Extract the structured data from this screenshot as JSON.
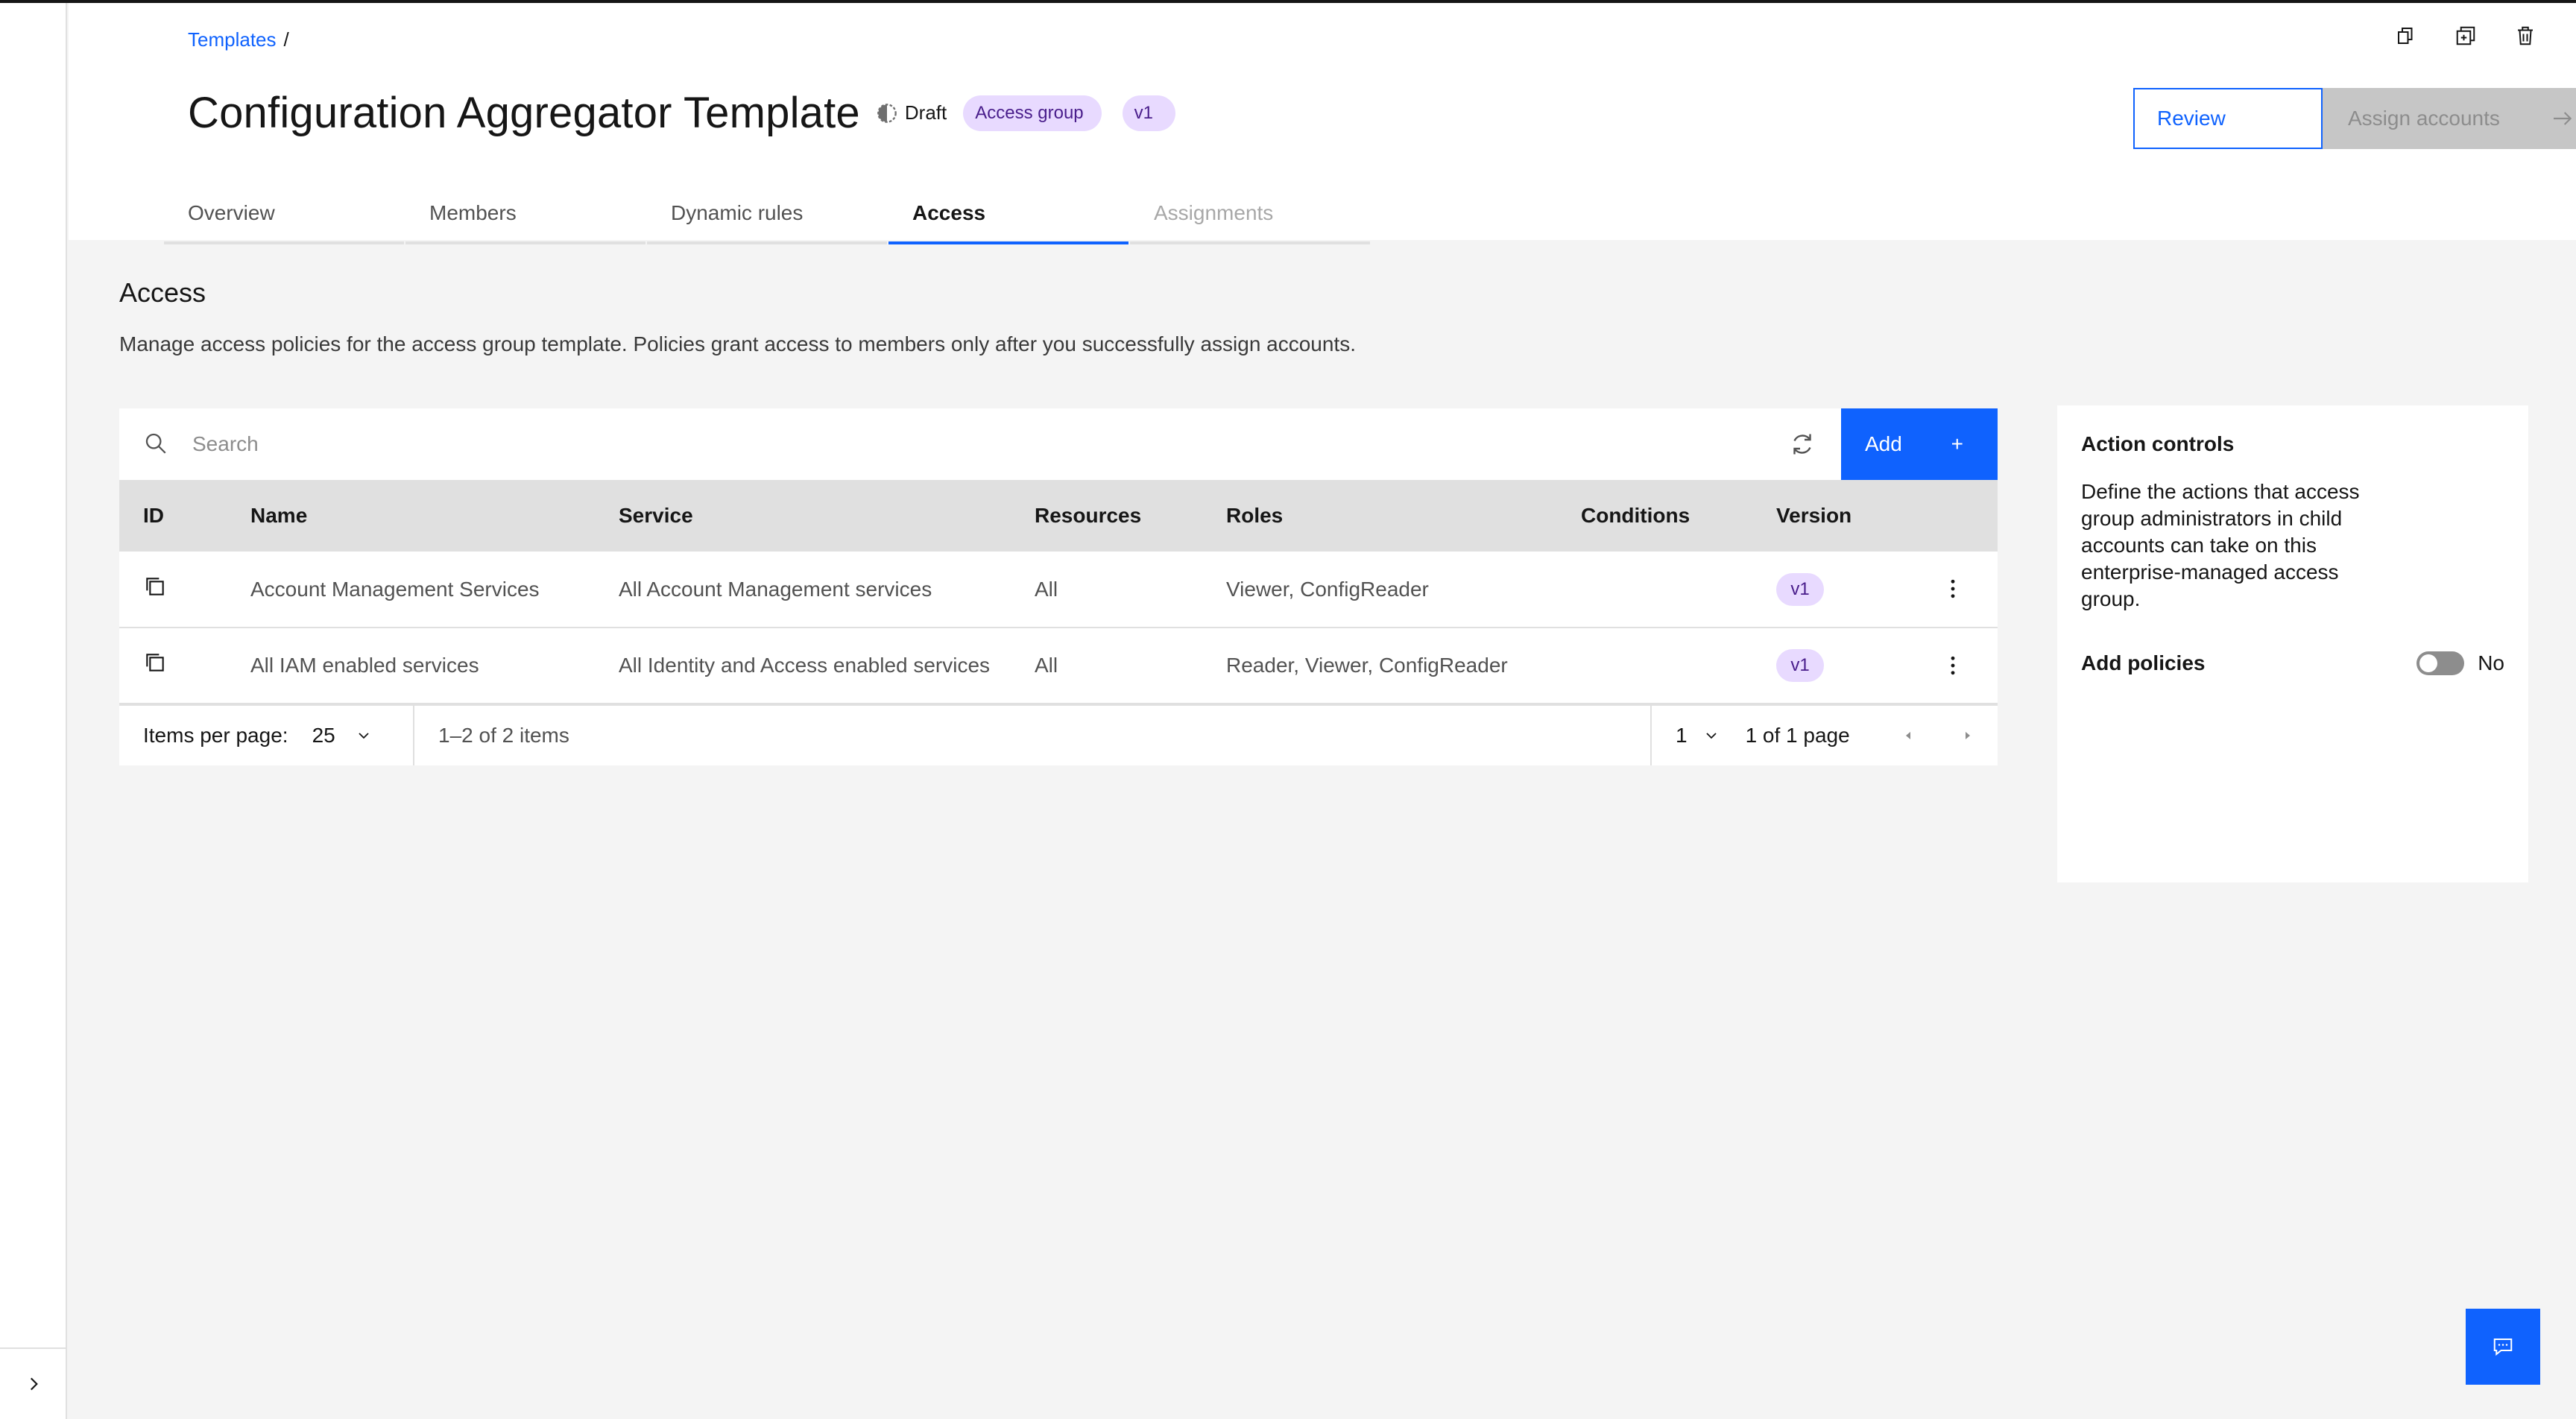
{
  "breadcrumb": {
    "link": "Templates",
    "separator": "/"
  },
  "header": {
    "title": "Configuration Aggregator Template",
    "status_icon": "half-circle-draft-icon",
    "status": "Draft",
    "tag_type": "Access group",
    "tag_version": "v1",
    "actions": {
      "copy": "copy-icon",
      "duplicate": "duplicate-icon",
      "delete": "trash-icon"
    },
    "review_label": "Review",
    "assign_label": "Assign accounts"
  },
  "tabs": [
    {
      "label": "Overview"
    },
    {
      "label": "Members"
    },
    {
      "label": "Dynamic rules"
    },
    {
      "label": "Access"
    },
    {
      "label": "Assignments"
    }
  ],
  "access": {
    "title": "Access",
    "description": "Manage access policies for the access group template. Policies grant access to members only after you successfully assign accounts.",
    "search_placeholder": "Search",
    "add_label": "Add",
    "add_symbol": "+",
    "columns": [
      "ID",
      "Name",
      "Service",
      "Resources",
      "Roles",
      "Conditions",
      "Version"
    ],
    "rows": [
      {
        "name": "Account Management Services",
        "service": "All Account Management services",
        "resources": "All",
        "roles": "Viewer, ConfigReader",
        "conditions": "",
        "version": "v1"
      },
      {
        "name": "All IAM enabled services",
        "service": "All Identity and Access enabled services",
        "resources": "All",
        "roles": "Reader, Viewer, ConfigReader",
        "conditions": "",
        "version": "v1"
      }
    ],
    "pagination": {
      "items_per_page_label": "Items per page:",
      "items_per_page": "25",
      "range": "1–2 of 2 items",
      "page": "1",
      "page_of": "1 of 1 page"
    }
  },
  "side_panel": {
    "title": "Action controls",
    "description": "Define the actions that access group administrators in child accounts can take on this enterprise-managed access group.",
    "add_policies_label": "Add policies",
    "add_policies_state": "No"
  },
  "colors": {
    "primary": "#0f62fe",
    "tag_bg": "#e8daff",
    "tag_text": "#491d8b",
    "background": "#f4f4f4"
  }
}
